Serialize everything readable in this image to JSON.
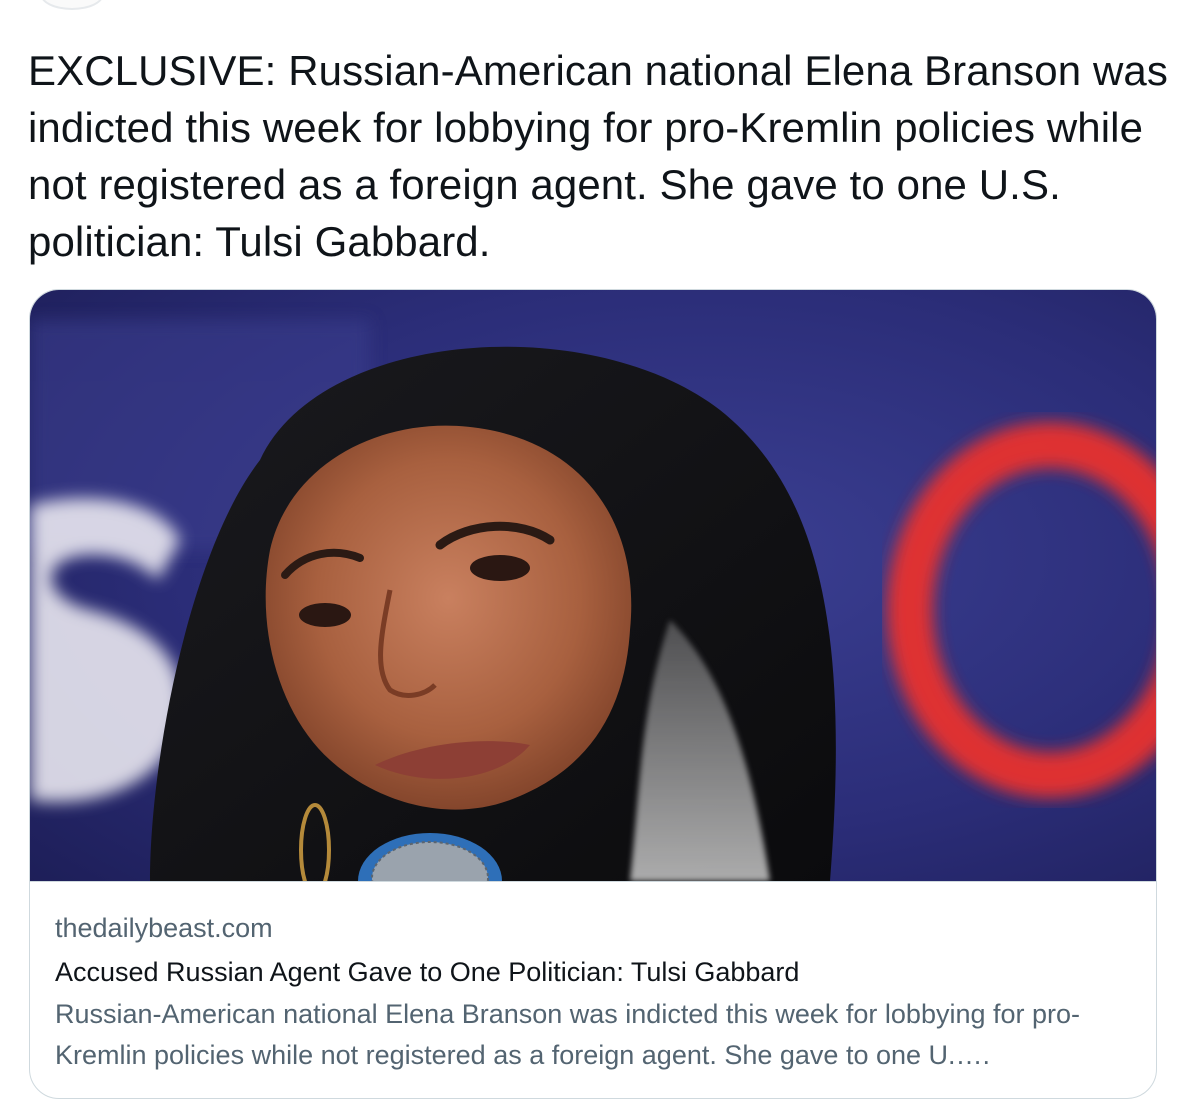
{
  "tweet": {
    "text": "EXCLUSIVE: Russian-American national Elena Branson was indicted this week for lobbying for pro-Kremlin policies while not registered as a foreign agent. She gave to one U.S. politician: Tulsi Gabbard."
  },
  "link_card": {
    "domain": "thedailybeast.com",
    "title": "Accused Russian Agent Gave to One Politician: Tulsi Gabbard",
    "description": "Russian-American national Elena Branson was indicted this week for lobbying for pro-Kremlin policies while not registered as a foreign agent. She gave to one U.….",
    "image": {
      "icon": "photo-of-woman-speaking-at-microphone"
    }
  },
  "colors": {
    "text_primary": "#0f1419",
    "text_secondary": "#536471",
    "card_border": "#cfd9de",
    "image_background": "#2d2f7a",
    "image_accent_red": "#e8332e"
  }
}
